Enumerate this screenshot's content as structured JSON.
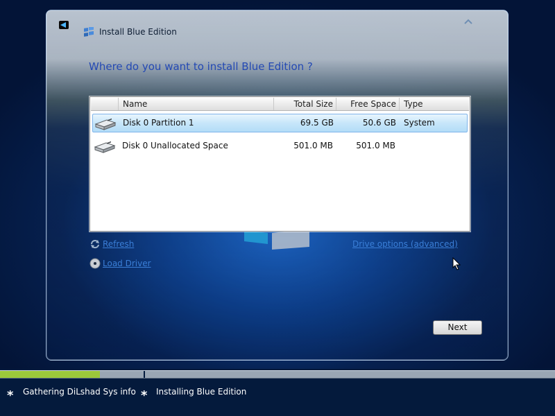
{
  "window": {
    "title": "Install Blue Edition",
    "question": "Where do you want to install Blue Edition ?"
  },
  "icons": {
    "back": "back-arrow-icon",
    "setup": "windows-setup-icon",
    "collapse": "chevron-up-icon",
    "disk": "hard-disk-icon",
    "refresh": "refresh-icon",
    "load_driver": "cd-disc-icon"
  },
  "table": {
    "headers": {
      "name": "Name",
      "total": "Total Size",
      "free": "Free Space",
      "type": "Type"
    },
    "rows": [
      {
        "name": "Disk 0 Partition 1",
        "total": "69.5 GB",
        "free": "50.6 GB",
        "type": "System",
        "selected": true
      },
      {
        "name": "Disk 0 Unallocated Space",
        "total": "501.0 MB",
        "free": "501.0 MB",
        "type": "",
        "selected": false
      }
    ]
  },
  "actions": {
    "refresh": "Refresh",
    "load_driver": "Load Driver",
    "drive_options": "Drive options (advanced)",
    "next": "Next"
  },
  "progress": {
    "steps": [
      "Gathering DiLshad Sys info",
      "Installing Blue Edition"
    ],
    "overall_fraction": 0.18
  },
  "colors": {
    "accent_link": "#3a7fd8",
    "progress_fill": "#9cc83a",
    "heading": "#2449b4"
  }
}
